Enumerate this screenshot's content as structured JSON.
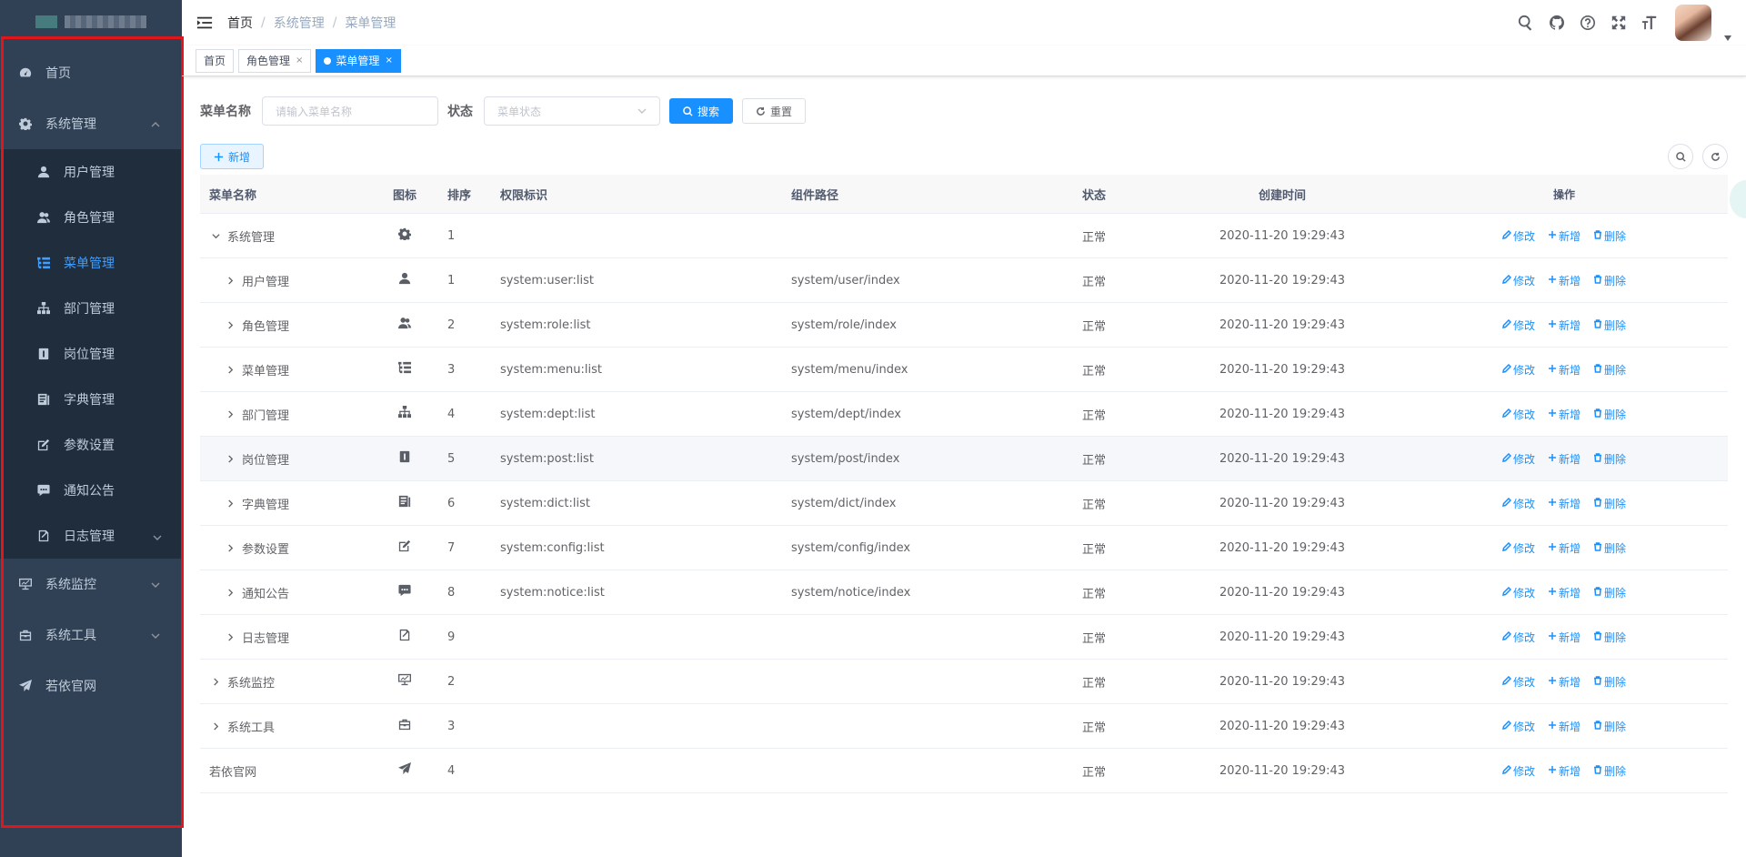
{
  "sidebar": {
    "items": [
      {
        "label": "首页",
        "icon": "dashboard-icon"
      },
      {
        "label": "系统管理",
        "icon": "gear-icon",
        "expanded": true,
        "children": [
          {
            "label": "用户管理",
            "icon": "user-icon"
          },
          {
            "label": "角色管理",
            "icon": "peoples-icon"
          },
          {
            "label": "菜单管理",
            "icon": "tree-table-icon",
            "active": true
          },
          {
            "label": "部门管理",
            "icon": "tree-icon"
          },
          {
            "label": "岗位管理",
            "icon": "post-icon"
          },
          {
            "label": "字典管理",
            "icon": "dict-icon"
          },
          {
            "label": "参数设置",
            "icon": "edit-icon"
          },
          {
            "label": "通知公告",
            "icon": "message-icon"
          },
          {
            "label": "日志管理",
            "icon": "log-icon"
          }
        ]
      },
      {
        "label": "系统监控",
        "icon": "monitor-icon"
      },
      {
        "label": "系统工具",
        "icon": "tool-icon"
      },
      {
        "label": "若依官网",
        "icon": "guide-icon"
      }
    ],
    "frame_color": "#e0161b"
  },
  "navbar": {
    "breadcrumb": [
      "首页",
      "系统管理",
      "菜单管理"
    ],
    "icons": [
      "search-icon",
      "github-icon",
      "question-icon",
      "fullscreen-icon",
      "font-size-icon"
    ]
  },
  "tags": [
    {
      "label": "首页",
      "closable": false
    },
    {
      "label": "角色管理",
      "closable": true
    },
    {
      "label": "菜单管理",
      "closable": true,
      "active": true
    }
  ],
  "search": {
    "name_label": "菜单名称",
    "name_placeholder": "请输入菜单名称",
    "status_label": "状态",
    "status_placeholder": "菜单状态",
    "search_btn": "搜索",
    "reset_btn": "重置"
  },
  "toolbar": {
    "add_btn": "新增"
  },
  "table": {
    "columns": [
      "菜单名称",
      "图标",
      "排序",
      "权限标识",
      "组件路径",
      "状态",
      "创建时间",
      "操作"
    ],
    "ops": {
      "edit": "修改",
      "add": "新增",
      "delete": "删除"
    },
    "rows": [
      {
        "name": "系统管理",
        "icon": "gear-icon",
        "order": "1",
        "perm": "",
        "comp": "",
        "status": "正常",
        "time": "2020-11-20 19:29:43",
        "level": 0,
        "expander": "down"
      },
      {
        "name": "用户管理",
        "icon": "user-icon",
        "order": "1",
        "perm": "system:user:list",
        "comp": "system/user/index",
        "status": "正常",
        "time": "2020-11-20 19:29:43",
        "level": 1,
        "expander": "right"
      },
      {
        "name": "角色管理",
        "icon": "peoples-icon",
        "order": "2",
        "perm": "system:role:list",
        "comp": "system/role/index",
        "status": "正常",
        "time": "2020-11-20 19:29:43",
        "level": 1,
        "expander": "right"
      },
      {
        "name": "菜单管理",
        "icon": "tree-table-icon",
        "order": "3",
        "perm": "system:menu:list",
        "comp": "system/menu/index",
        "status": "正常",
        "time": "2020-11-20 19:29:43",
        "level": 1,
        "expander": "right"
      },
      {
        "name": "部门管理",
        "icon": "tree-icon",
        "order": "4",
        "perm": "system:dept:list",
        "comp": "system/dept/index",
        "status": "正常",
        "time": "2020-11-20 19:29:43",
        "level": 1,
        "expander": "right"
      },
      {
        "name": "岗位管理",
        "icon": "post-icon",
        "order": "5",
        "perm": "system:post:list",
        "comp": "system/post/index",
        "status": "正常",
        "time": "2020-11-20 19:29:43",
        "level": 1,
        "expander": "right",
        "hover": true
      },
      {
        "name": "字典管理",
        "icon": "dict-icon",
        "order": "6",
        "perm": "system:dict:list",
        "comp": "system/dict/index",
        "status": "正常",
        "time": "2020-11-20 19:29:43",
        "level": 1,
        "expander": "right"
      },
      {
        "name": "参数设置",
        "icon": "edit-icon",
        "order": "7",
        "perm": "system:config:list",
        "comp": "system/config/index",
        "status": "正常",
        "time": "2020-11-20 19:29:43",
        "level": 1,
        "expander": "right"
      },
      {
        "name": "通知公告",
        "icon": "message-icon",
        "order": "8",
        "perm": "system:notice:list",
        "comp": "system/notice/index",
        "status": "正常",
        "time": "2020-11-20 19:29:43",
        "level": 1,
        "expander": "right"
      },
      {
        "name": "日志管理",
        "icon": "log-icon",
        "order": "9",
        "perm": "",
        "comp": "",
        "status": "正常",
        "time": "2020-11-20 19:29:43",
        "level": 1,
        "expander": "right"
      },
      {
        "name": "系统监控",
        "icon": "monitor-icon",
        "order": "2",
        "perm": "",
        "comp": "",
        "status": "正常",
        "time": "2020-11-20 19:29:43",
        "level": 0,
        "expander": "right"
      },
      {
        "name": "系统工具",
        "icon": "tool-icon",
        "order": "3",
        "perm": "",
        "comp": "",
        "status": "正常",
        "time": "2020-11-20 19:29:43",
        "level": 0,
        "expander": "right"
      },
      {
        "name": "若依官网",
        "icon": "guide-icon",
        "order": "4",
        "perm": "",
        "comp": "",
        "status": "正常",
        "time": "2020-11-20 19:29:43",
        "level": 0,
        "expander": "none"
      }
    ]
  },
  "colors": {
    "sidebar_bg": "#304156",
    "submenu_bg": "#1f2d3d",
    "accent": "#1890ff",
    "active_menu": "#409eff"
  }
}
